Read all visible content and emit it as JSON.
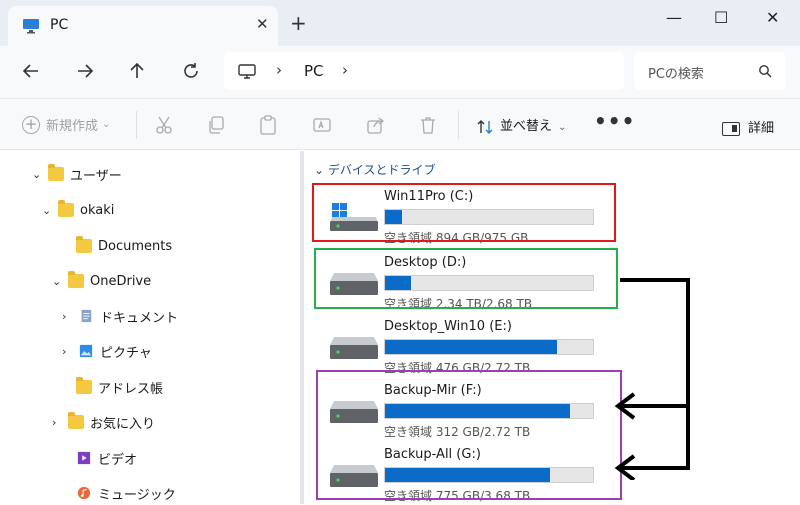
{
  "window": {
    "tab_title": "PC",
    "new_tab": "+",
    "min": "—",
    "max": "☐",
    "close": "✕"
  },
  "address": {
    "crumb": "PC",
    "search_placeholder": "PCの検索"
  },
  "toolbar": {
    "new_label": "新規作成",
    "sort_label": "並べ替え",
    "more_label": "•••",
    "details_label": "詳細"
  },
  "sidebar": {
    "items": [
      {
        "label": "ユーザー"
      },
      {
        "label": "okaki"
      },
      {
        "label": "Documents"
      },
      {
        "label": "OneDrive"
      },
      {
        "label": "ドキュメント"
      },
      {
        "label": "ピクチャ"
      },
      {
        "label": "アドレス帳"
      },
      {
        "label": "お気に入り"
      },
      {
        "label": "ビデオ"
      },
      {
        "label": "ミュージック"
      }
    ]
  },
  "main": {
    "group_title": "デバイスとドライブ",
    "drives": [
      {
        "name": "Win11Pro (C:)",
        "free": "空き領域 894 GB/975 GB",
        "used_fraction": 0.083,
        "os_drive": true
      },
      {
        "name": "Desktop (D:)",
        "free": "空き領域 2.34 TB/2.68 TB",
        "used_fraction": 0.127
      },
      {
        "name": "Desktop_Win10 (E:)",
        "free": "空き領域 476 GB/2.72 TB",
        "used_fraction": 0.829
      },
      {
        "name": "Backup-Mir (F:)",
        "free": "空き領域 312 GB/2.72 TB",
        "used_fraction": 0.888
      },
      {
        "name": "Backup-All (G:)",
        "free": "空き領域 775 GB/3.68 TB",
        "used_fraction": 0.794
      }
    ]
  },
  "colors": {
    "annotation_red": "#e0191f",
    "annotation_green": "#22b04a",
    "annotation_purple": "#9b3fb3",
    "bar_fill": "#0a6cc8"
  }
}
